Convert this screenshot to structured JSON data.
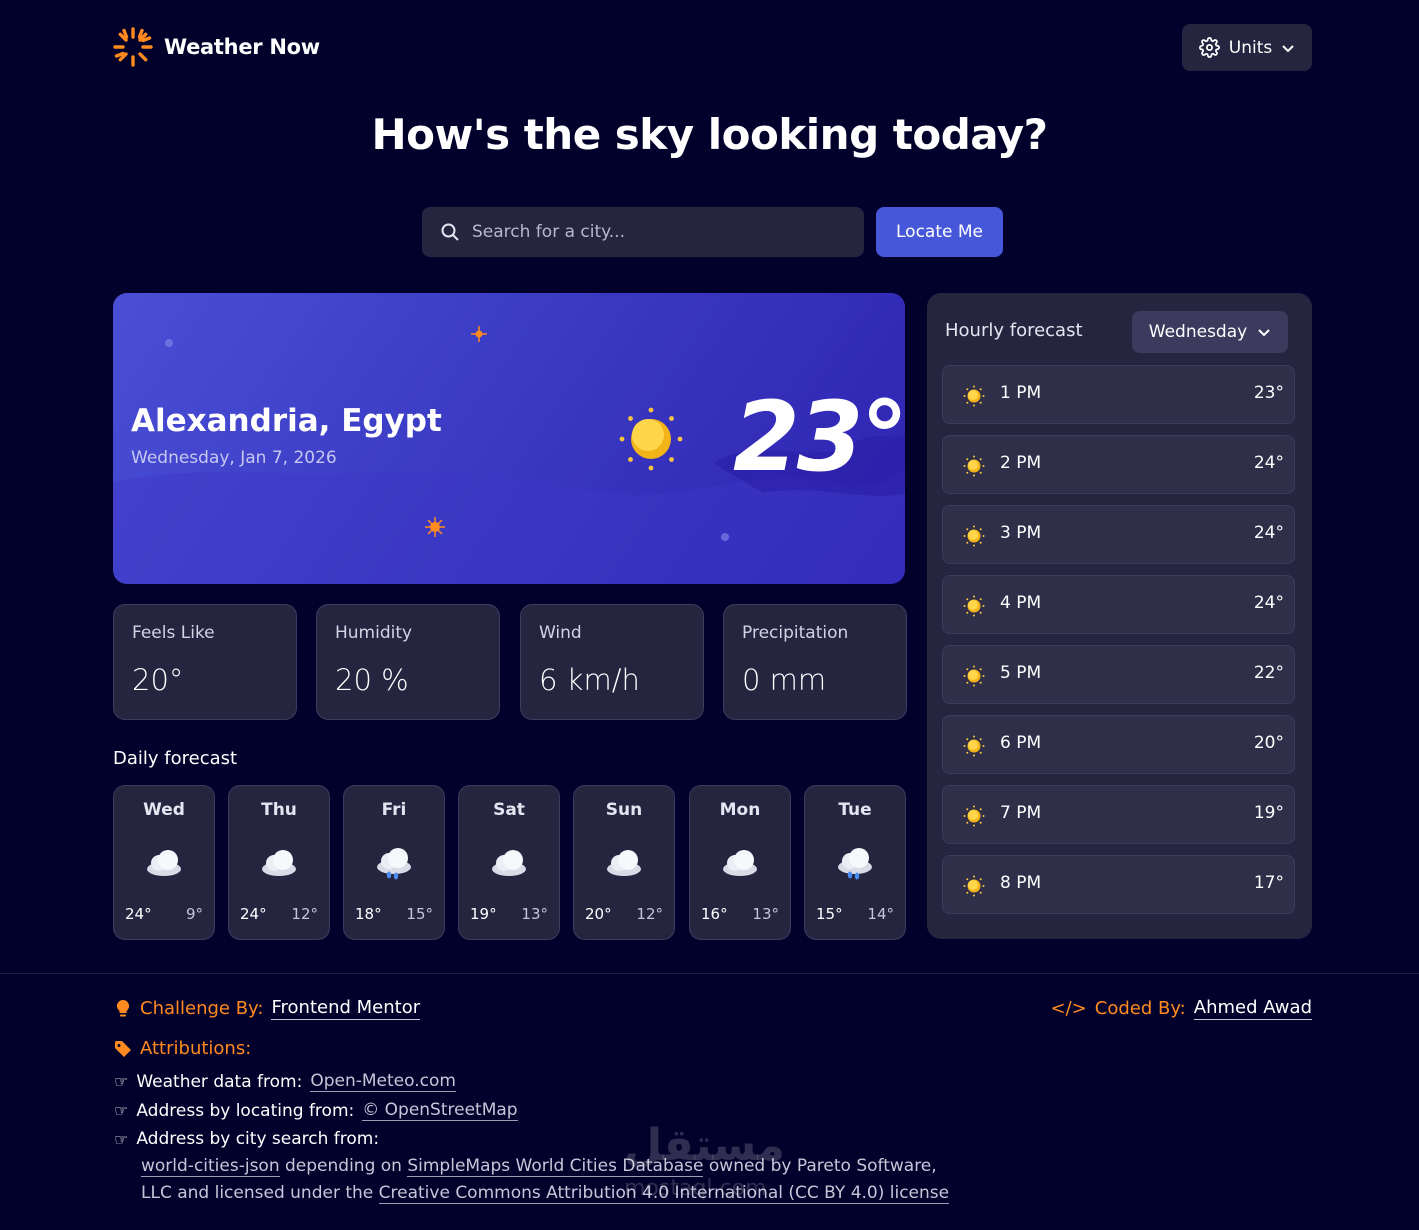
{
  "header": {
    "logo_text": "Weather Now",
    "units_label": "Units"
  },
  "headline": "How's the sky looking today?",
  "search": {
    "placeholder": "Search for a city...",
    "locate_label": "Locate Me"
  },
  "current": {
    "location": "Alexandria, Egypt",
    "date": "Wednesday, Jan 7, 2026",
    "temperature": "23°",
    "icon": "sun-icon"
  },
  "stats": [
    {
      "label": "Feels Like",
      "value": "20°"
    },
    {
      "label": "Humidity",
      "value": "20 %"
    },
    {
      "label": "Wind",
      "value": "6 km/h"
    },
    {
      "label": "Precipitation",
      "value": "0 mm"
    }
  ],
  "daily": {
    "title": "Daily forecast",
    "days": [
      {
        "name": "Wed",
        "icon": "cloud-icon",
        "hi": "24°",
        "lo": "9°"
      },
      {
        "name": "Thu",
        "icon": "cloud-icon",
        "hi": "24°",
        "lo": "12°"
      },
      {
        "name": "Fri",
        "icon": "rain-cloud-icon",
        "hi": "18°",
        "lo": "15°"
      },
      {
        "name": "Sat",
        "icon": "cloud-icon",
        "hi": "19°",
        "lo": "13°"
      },
      {
        "name": "Sun",
        "icon": "cloud-icon",
        "hi": "20°",
        "lo": "12°"
      },
      {
        "name": "Mon",
        "icon": "cloud-icon",
        "hi": "16°",
        "lo": "13°"
      },
      {
        "name": "Tue",
        "icon": "rain-cloud-icon",
        "hi": "15°",
        "lo": "14°"
      }
    ]
  },
  "hourly": {
    "title": "Hourly forecast",
    "selected_day": "Wednesday",
    "hours": [
      {
        "time": "1 PM",
        "temp": "23°",
        "icon": "sun-icon"
      },
      {
        "time": "2 PM",
        "temp": "24°",
        "icon": "sun-icon"
      },
      {
        "time": "3 PM",
        "temp": "24°",
        "icon": "sun-icon"
      },
      {
        "time": "4 PM",
        "temp": "24°",
        "icon": "sun-icon"
      },
      {
        "time": "5 PM",
        "temp": "22°",
        "icon": "sun-icon"
      },
      {
        "time": "6 PM",
        "temp": "20°",
        "icon": "sun-icon"
      },
      {
        "time": "7 PM",
        "temp": "19°",
        "icon": "sun-icon"
      },
      {
        "time": "8 PM",
        "temp": "17°",
        "icon": "sun-icon"
      }
    ]
  },
  "footer": {
    "challenge_label": "Challenge By:",
    "challenge_link": "Frontend Mentor",
    "coded_label": "Coded By:",
    "coded_link": "Ahmed Awad",
    "attributions_label": "Attributions:",
    "weather_label": "Weather data from:",
    "weather_link": "Open-Meteo.com",
    "locate_label": "Address by locating from:",
    "locate_link": "© OpenStreetMap",
    "city_label": "Address by city search from:",
    "city_link1": "world-cities-json",
    "city_text1": "depending on",
    "city_link2": "SimpleMaps World Cities Database",
    "city_text2": "owned by Pareto Software,",
    "city_text3": "LLC and licensed under the",
    "city_link3": "Creative Commons Attribution 4.0 International (CC BY 4.0) license"
  },
  "watermark": {
    "arabic": "مستقل",
    "latin": "mostaql.com"
  },
  "colors": {
    "background": "#02012b",
    "card": "#262540",
    "accent_blue": "#4658d9",
    "accent_orange": "#ff8a1f"
  }
}
